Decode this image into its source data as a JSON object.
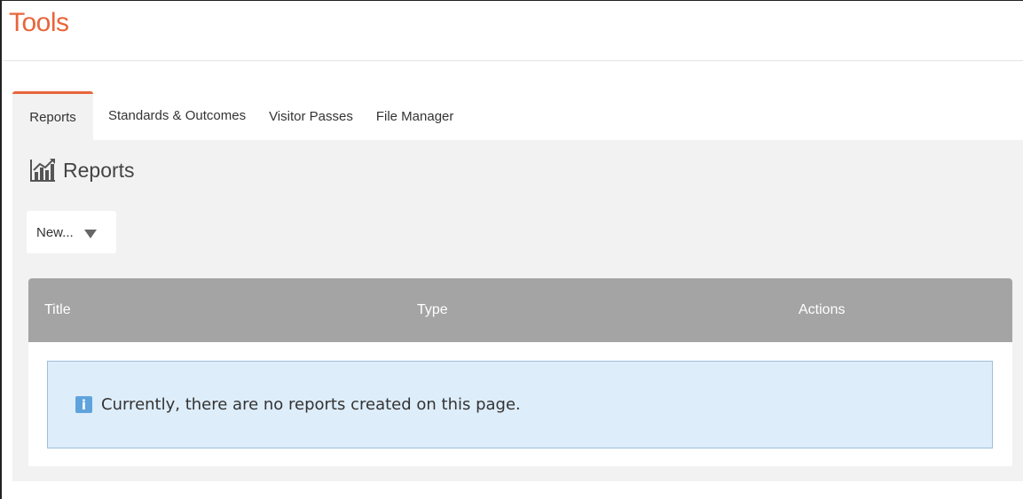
{
  "page": {
    "title": "Tools"
  },
  "tabs": [
    {
      "label": "Reports",
      "active": true
    },
    {
      "label": "Standards & Outcomes",
      "active": false
    },
    {
      "label": "Visitor Passes",
      "active": false
    },
    {
      "label": "File Manager",
      "active": false
    }
  ],
  "section": {
    "title": "Reports",
    "icon": "bar-chart-icon"
  },
  "new_dropdown": {
    "label": "New...",
    "icon": "caret-down-icon"
  },
  "table": {
    "columns": [
      "Title",
      "Type",
      "Actions"
    ],
    "empty_message": "Currently, there are no reports created on this page.",
    "empty_icon": "info-icon",
    "empty_icon_glyph": "i"
  },
  "colors": {
    "accent": "#e8653a",
    "table_header": "#a4a4a4",
    "info_background": "#deedfa",
    "info_icon": "#5fa3dd"
  }
}
